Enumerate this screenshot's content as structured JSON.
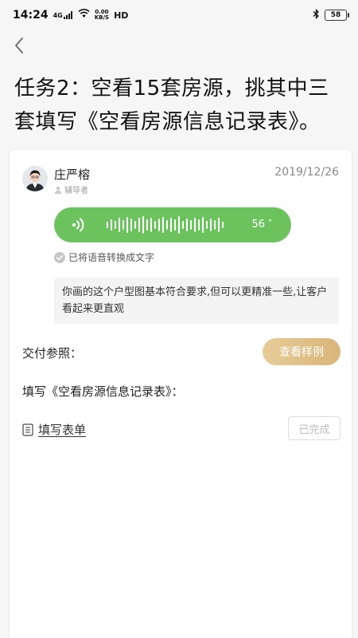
{
  "status_bar": {
    "time": "14:24",
    "network": "4G",
    "speed_value": "0.00",
    "speed_unit": "KB/S",
    "hd": "HD",
    "battery": "58"
  },
  "header": {
    "title": "任务2：空看15套房源，挑其中三套填写《空看房源信息记录表》。"
  },
  "message": {
    "mentor_name": "庄严榕",
    "mentor_role": "辅导者",
    "date": "2019/12/26",
    "voice_duration": "56 ″",
    "converted_text": "已将语音转换成文字",
    "transcript": "你画的这个户型图基本符合要求,但可以更精准一些,让客户看起来更直观"
  },
  "delivery": {
    "label": "交付参照：",
    "view_sample_label": "查看样例"
  },
  "form_section": {
    "label": "填写《空看房源信息记录表》：",
    "link_label": "填写表单",
    "status_label": "已完成"
  },
  "colors": {
    "voice_green": "#6cc35e",
    "gold_button": "#ddb97c"
  }
}
